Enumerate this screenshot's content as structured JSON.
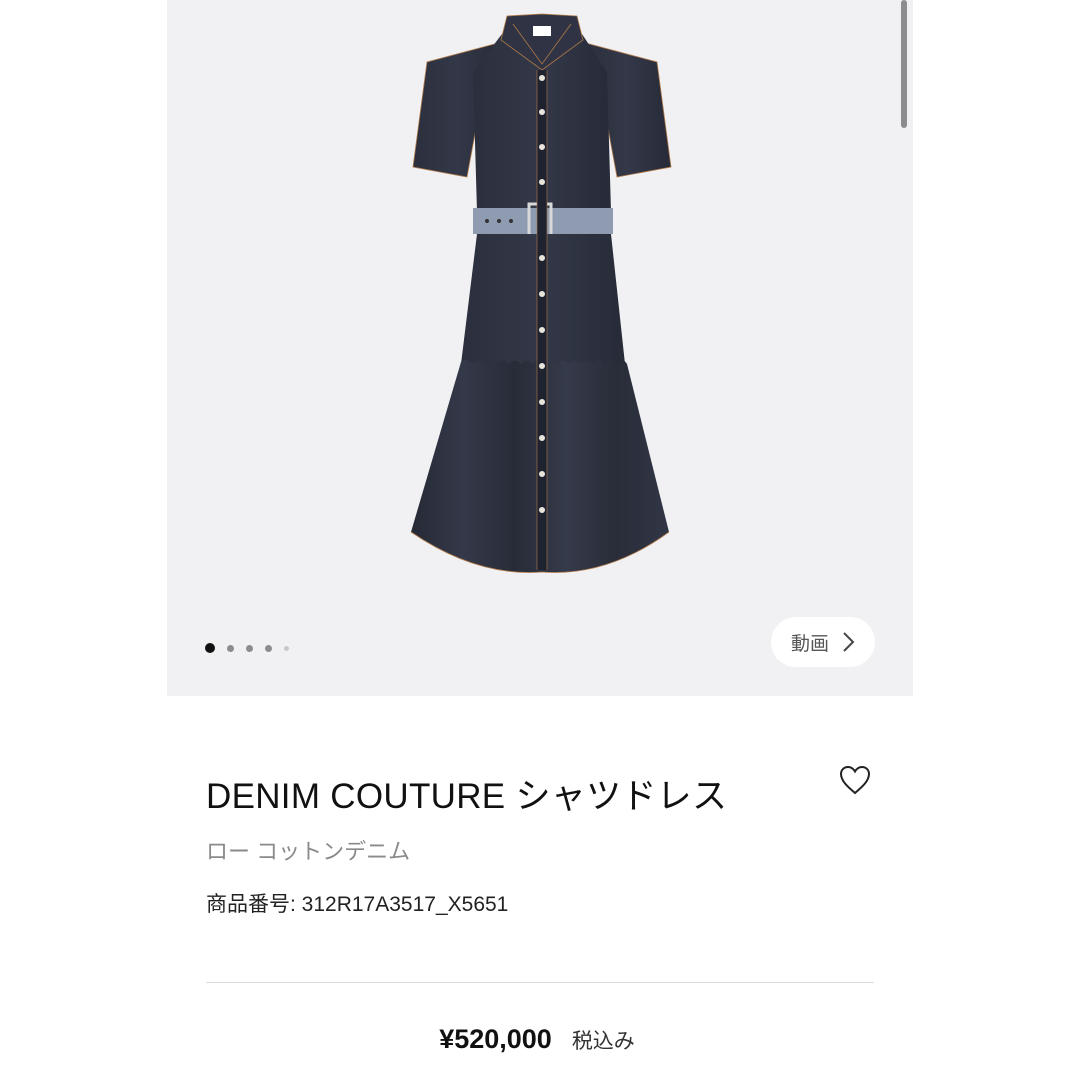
{
  "gallery": {
    "image_alt": "Denim shirt dress",
    "slide_count": 5,
    "active_slide": 0,
    "video_button_label": "動画"
  },
  "product": {
    "title": "DENIM COUTURE シャツドレス",
    "material": "ロー コットンデニム",
    "sku": "商品番号: 312R17A3517_X5651",
    "price": "¥520,000",
    "tax_note": "税込み",
    "favorite_icon": "heart-icon"
  },
  "colors": {
    "gallery_bg": "#f1f1f3",
    "denim": "#2a2e3c",
    "belt": "#8e9bb0",
    "dot_active": "#111111",
    "dot_inactive": "#8c8c8c"
  }
}
